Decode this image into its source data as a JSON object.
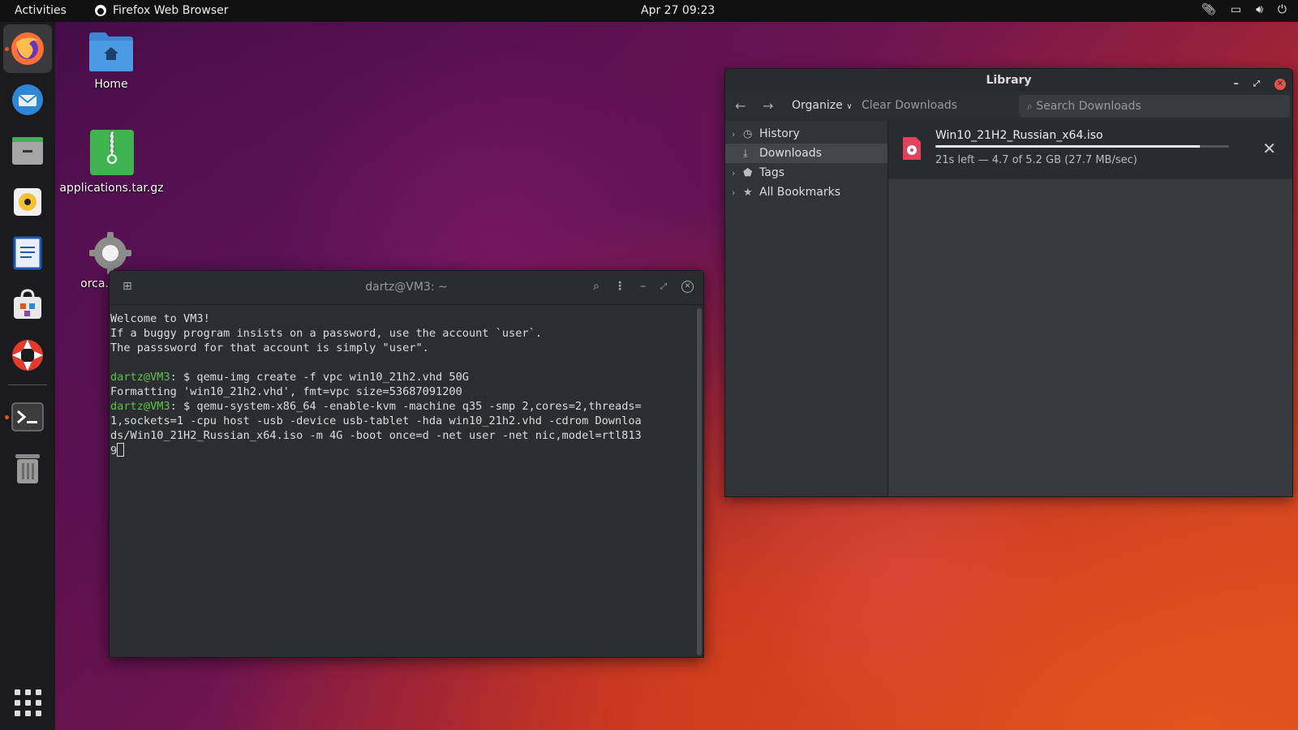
{
  "topbar": {
    "activities": "Activities",
    "app_name": "Firefox Web Browser",
    "clock": "Apr 27  09:23"
  },
  "dock": {
    "items": [
      "firefox-icon",
      "thunderbird-icon",
      "files-icon",
      "rhythmbox-icon",
      "writer-icon",
      "software-icon",
      "help-icon",
      "terminal-icon",
      "trash-icon"
    ]
  },
  "desktop": {
    "icons": [
      {
        "label": "Home"
      },
      {
        "label": "applications.tar.gz"
      },
      {
        "label": "orca.d"
      }
    ]
  },
  "library": {
    "title": "Library",
    "organize": "Organize",
    "clear": "Clear Downloads",
    "search_placeholder": "Search Downloads",
    "sidebar": [
      {
        "label": "History"
      },
      {
        "label": "Downloads"
      },
      {
        "label": "Tags"
      },
      {
        "label": "All Bookmarks"
      }
    ],
    "download": {
      "name": "Win10_21H2_Russian_x64.iso",
      "status": "21s left — 4.7 of 5.2 GB (27.7 MB/sec)",
      "progress": 0.9
    }
  },
  "terminal": {
    "title": "dartz@VM3: ~",
    "lines": {
      "l1": "Welcome to VM3!",
      "l2": "If a buggy program insists on a password, use the account `user`.",
      "l3": "The passsword for that account is simply \"user\".",
      "p1": "dartz@VM3",
      "c1": ": $ qemu-img create -f vpc win10_21h2.vhd 50G",
      "l4": "Formatting 'win10_21h2.vhd', fmt=vpc size=53687091200",
      "p2": "dartz@VM3",
      "c2": ": $ qemu-system-x86_64 -enable-kvm -machine q35 -smp 2,cores=2,threads=",
      "c3": "1,sockets=1 -cpu host -usb -device usb-tablet -hda win10_21h2.vhd -cdrom Downloa",
      "c4": "ds/Win10_21H2_Russian_x64.iso -m 4G -boot once=d -net user -net nic,model=rtl813",
      "c5": "9"
    }
  },
  "colors": {
    "accent": "#e95420",
    "prompt": "#5ec24a"
  }
}
